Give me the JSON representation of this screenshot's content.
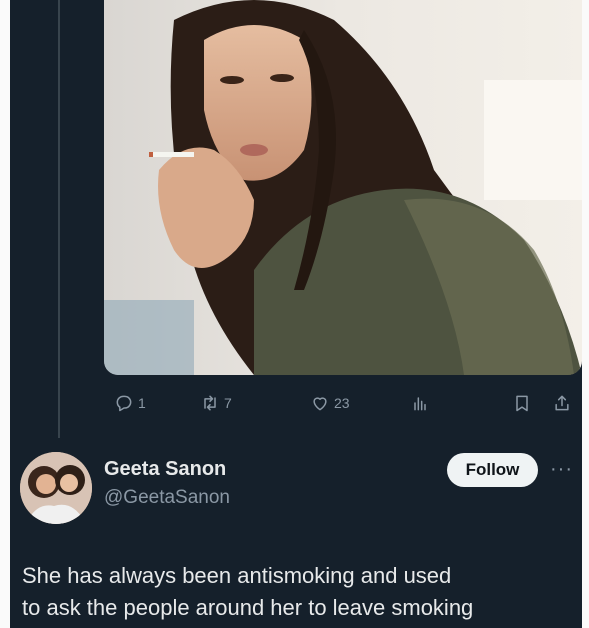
{
  "tweet_top": {
    "stats": {
      "replies": "1",
      "reposts": "7",
      "likes": "23"
    }
  },
  "tweet_bottom": {
    "author_name": "Geeta Sanon",
    "author_handle": "@GeetaSanon",
    "follow_label": "Follow",
    "more_label": "···",
    "text": "She has always been antismoking  and  used\nto ask the people around her to leave smoking"
  },
  "icons": [
    "reply-icon",
    "repost-icon",
    "like-icon",
    "views-icon",
    "bookmark-icon",
    "share-icon"
  ],
  "colors": {
    "background": "#15202b",
    "text_primary": "#e7e9ea",
    "text_secondary": "#8b98a5",
    "follow_bg": "#eff3f4"
  }
}
